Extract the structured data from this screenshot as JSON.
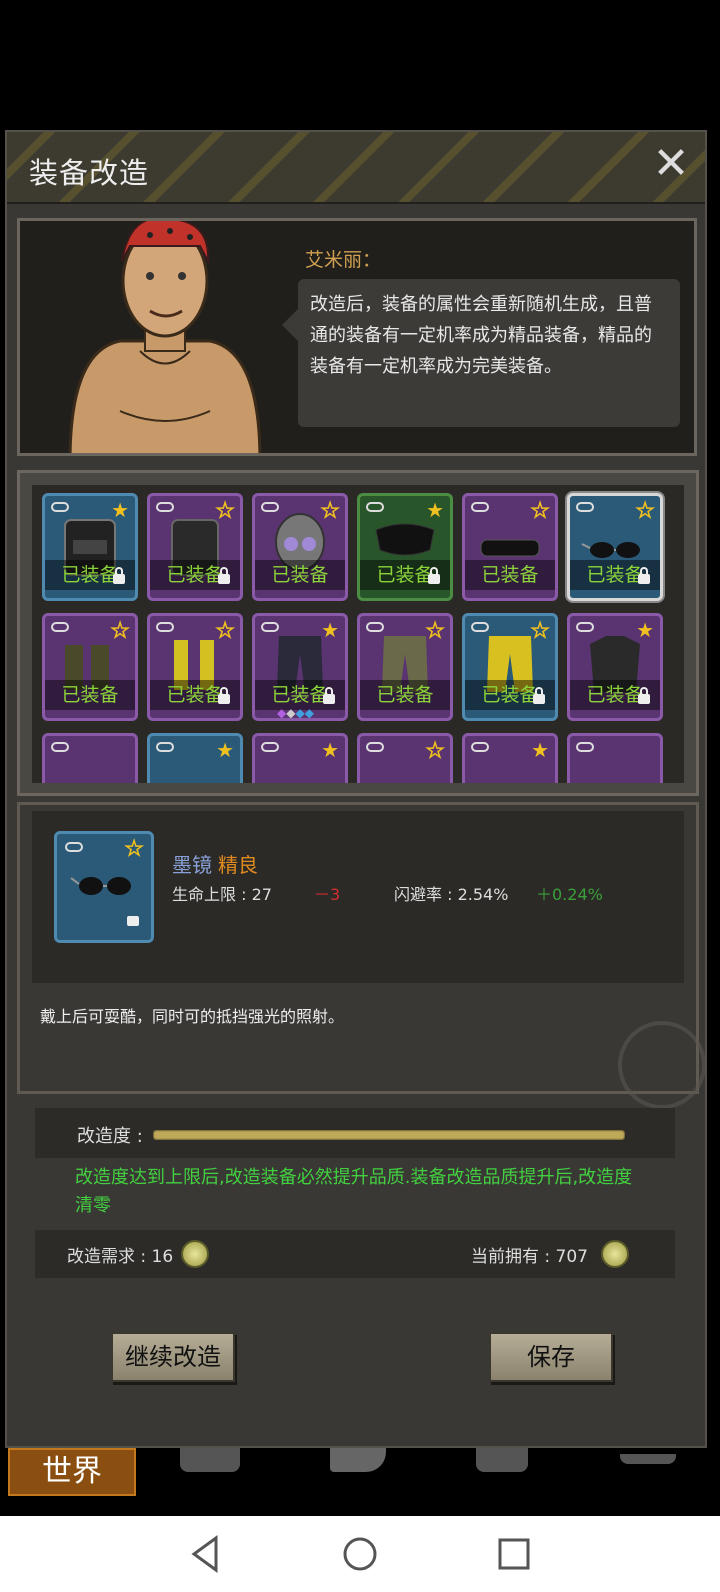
{
  "dialog": {
    "title": "装备改造",
    "close_label": "✕"
  },
  "npc": {
    "name": "艾米丽：",
    "speech": "改造后，装备的属性会重新随机生成，且普通的装备有一定机率成为精品装备，精品的装备有一定机率成为完美装备。"
  },
  "inventory": {
    "equipped_label": "已装备",
    "row1": [
      "已装备",
      "已装备",
      "已装备",
      "已装备",
      "已装备",
      "已装备"
    ],
    "row2": [
      "已装备",
      "已装备",
      "已装备",
      "已装备",
      "已装备",
      "已装备"
    ]
  },
  "selected_item": {
    "name": "墨镜",
    "quality": "精良",
    "stat1_name": "生命上限 : 27",
    "stat1_delta": "－3",
    "stat2_name": "闪避率 : 2.54%",
    "stat2_delta": "＋0.24%",
    "description": "戴上后可耍酷，同时可的抵挡强光的照射。"
  },
  "modification": {
    "progress_label": "改造度 :",
    "progress": 1.0,
    "note": "改造度达到上限后,改造装备必然提升品质.装备改造品质提升后,改造度清零",
    "cost_label": "改造需求 : 16",
    "owned_label": "当前拥有 : 707"
  },
  "buttons": {
    "continue": "继续改造",
    "save": "保存"
  },
  "bottom_nav": {
    "world": "世界"
  },
  "colors": {
    "equipped_text": "#8cd43a",
    "quality_orange": "#e08a20",
    "note_green": "#42d040",
    "negative": "#d03030",
    "positive": "#3aa03a"
  }
}
